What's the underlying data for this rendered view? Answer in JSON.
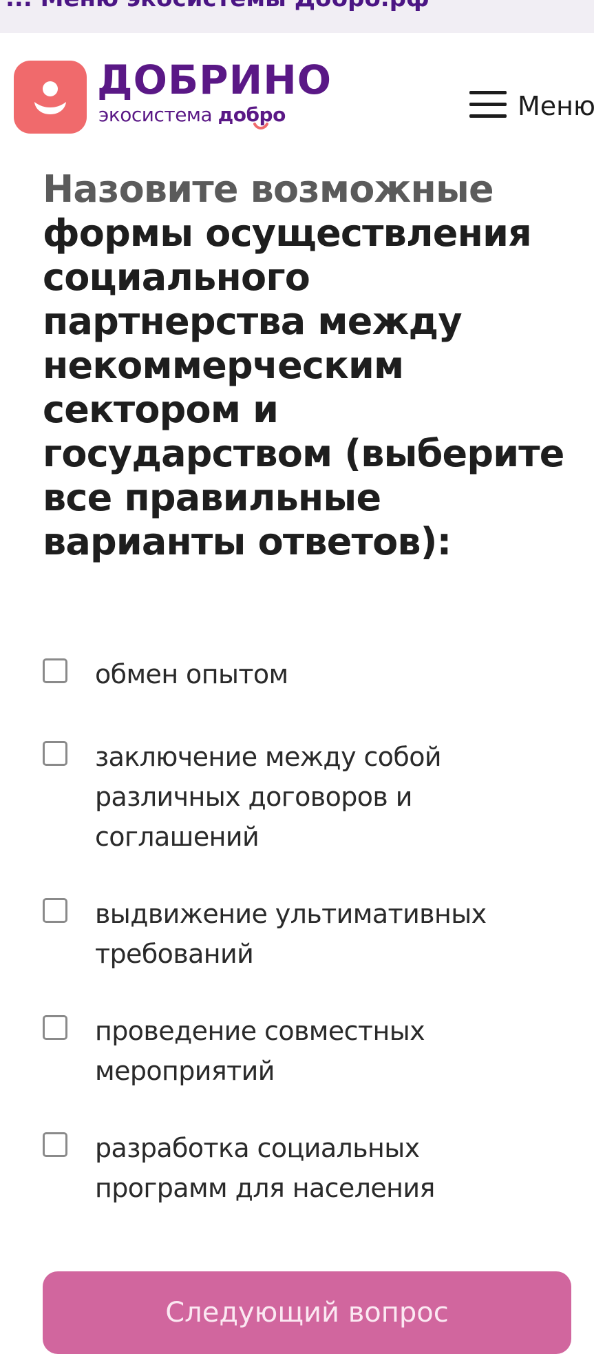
{
  "top_banner": {
    "text": "... Меню экосистемы Добро.рф"
  },
  "header": {
    "brand_name": "ДОБРИНО",
    "brand_tagline_prefix": "экосистема ",
    "brand_tagline_strong": "добро",
    "menu_label": "Меню",
    "logo_color": "#f06a6c",
    "brand_color": "#5a1886"
  },
  "question": {
    "lead": "Назовите возможные",
    "rest": "формы осуществления социального партнерства между некоммерческим сектором и государством (выберите все правильные варианты ответов):"
  },
  "options": [
    {
      "label": "обмен опытом",
      "checked": false
    },
    {
      "label": "заключение между собой различных договоров и соглашений",
      "checked": false
    },
    {
      "label": "выдвижение ультимативных требований",
      "checked": false
    },
    {
      "label": "проведение совместных мероприятий",
      "checked": false
    },
    {
      "label": "разработка социальных программ для населения",
      "checked": false
    }
  ],
  "next_button": {
    "label": "Следующий вопрос",
    "color": "#d1669e"
  }
}
